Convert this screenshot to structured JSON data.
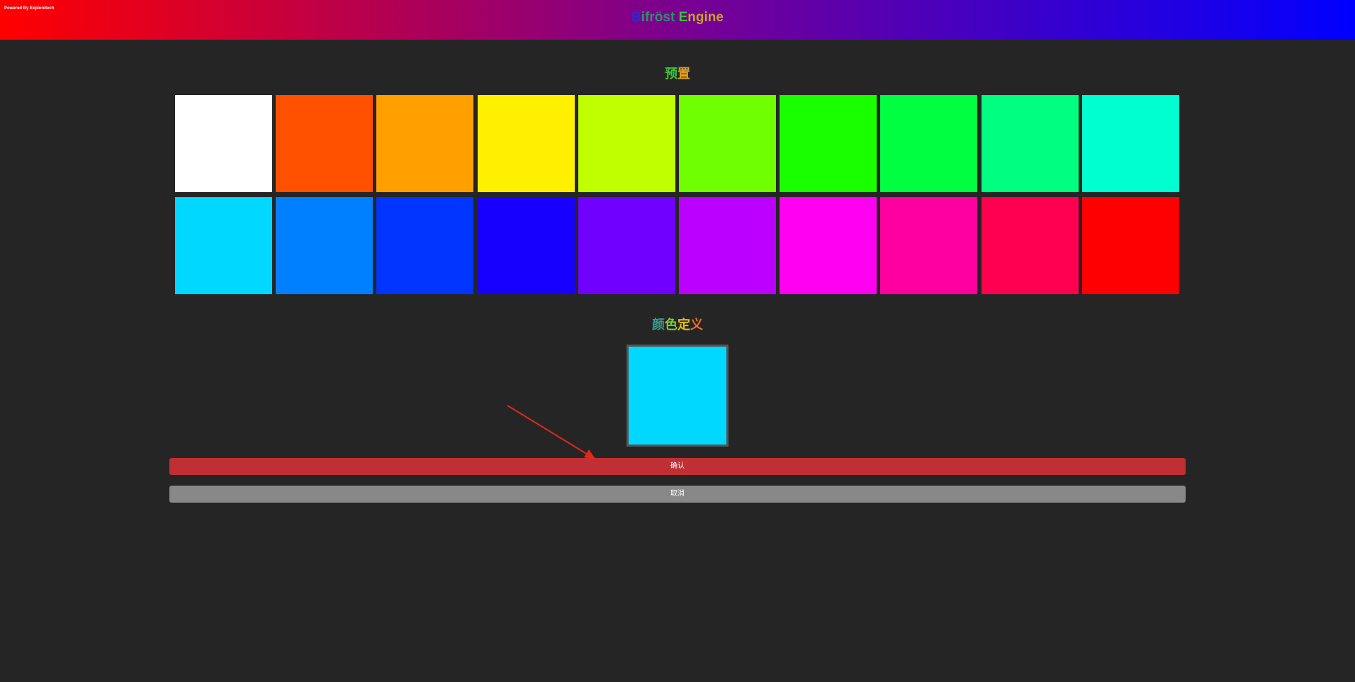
{
  "header": {
    "powered_by": "Powered By Exploretech",
    "title_parts": [
      {
        "text": "B",
        "color": "#2a2ad6"
      },
      {
        "text": "ifröst ",
        "color": "#2f8f6f"
      },
      {
        "text": "E",
        "color": "#39c43a"
      },
      {
        "text": "ngine",
        "color": "#c8a030"
      }
    ]
  },
  "preset": {
    "title_parts": [
      {
        "text": "预",
        "color": "#3fc43a"
      },
      {
        "text": "置",
        "color": "#e0a020"
      }
    ],
    "swatches": [
      "#ffffff",
      "#ff5000",
      "#ffa000",
      "#fff000",
      "#bfff00",
      "#70ff00",
      "#1aff00",
      "#00ff40",
      "#00ff80",
      "#00ffd0",
      "#00d8ff",
      "#0080ff",
      "#0034ff",
      "#1800ff",
      "#7000ff",
      "#bc00ff",
      "#ff00f0",
      "#ff00a0",
      "#ff0050",
      "#ff0000"
    ]
  },
  "custom": {
    "title_parts": [
      {
        "text": "颜",
        "color": "#3a9a8a"
      },
      {
        "text": "色",
        "color": "#7ad030"
      },
      {
        "text": "定",
        "color": "#e0c020"
      },
      {
        "text": "义",
        "color": "#f07020"
      }
    ],
    "current_color": "#00d8ff"
  },
  "actions": {
    "confirm_label": "确认",
    "cancel_label": "取消"
  },
  "colors": {
    "confirm_bg": "#bf2f33",
    "cancel_bg": "#888888",
    "annotation_arrow": "#e0281c"
  }
}
